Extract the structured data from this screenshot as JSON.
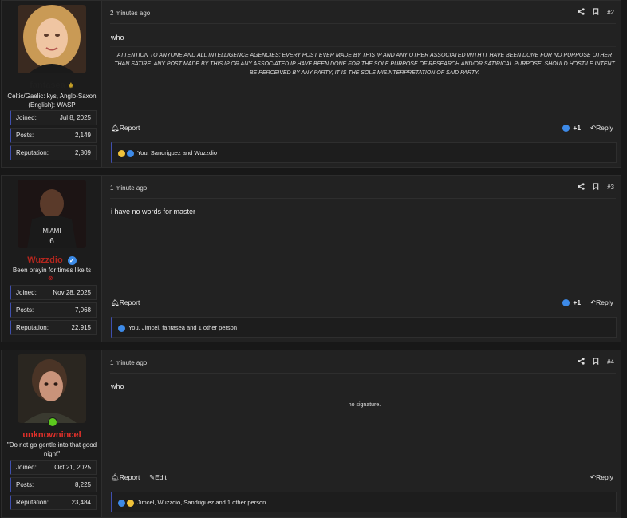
{
  "posts": [
    {
      "username": "fantasea",
      "user_title": "Celtic/Gaelic: kys, Anglo-Saxon (English): WASP",
      "joined_label": "Joined:",
      "joined": "Jul 8, 2025",
      "posts_label": "Posts:",
      "posts": "2,149",
      "rep_label": "Reputation:",
      "reputation": "2,809",
      "time": "2 minutes ago",
      "number": "#2",
      "message": "who",
      "signature": "ATTENTION TO ANYONE AND ALL INTELLIGENCE AGENCIES: EVERY POST EVER MADE BY THIS IP AND ANY OTHER ASSOCIATED WITH IT HAVE BEEN DONE FOR NO PURPOSE OTHER THAN SATIRE. ANY POST MADE BY THIS IP OR ANY ASSOCIATED IP HAVE BEEN DONE FOR THE SOLE PURPOSE OF RESEARCH AND/OR SATIRICAL PURPOSE. SHOULD HOSTILE INTENT BE PERCEIVED BY ANY PARTY, IT IS THE SOLE MISINTERPRETATION OF SAID PARTY.",
      "report": "Report",
      "score": "+1",
      "reply": "Reply",
      "reactions": "You, Sandriguez and Wuzzdio",
      "name_color": "#1f1f1f"
    },
    {
      "username": "Wuzzdio",
      "user_title": "Been prayin for times like ts",
      "joined_label": "Joined:",
      "joined": "Nov 28, 2025",
      "posts_label": "Posts:",
      "posts": "7,068",
      "rep_label": "Reputation:",
      "reputation": "22,915",
      "time": "1 minute ago",
      "number": "#3",
      "message": "i have no words for master",
      "report": "Report",
      "score": "+1",
      "reply": "Reply",
      "reactions": "You, Jimcel, fantasea and 1 other person",
      "name_color": "#b3261e"
    },
    {
      "username": "unknownincel",
      "user_title": "\"Do not go gentle into that good night\"",
      "joined_label": "Joined:",
      "joined": "Oct 21, 2025",
      "posts_label": "Posts:",
      "posts": "8,225",
      "rep_label": "Reputation:",
      "reputation": "23,484",
      "time": "1 minute ago",
      "number": "#4",
      "message": "who",
      "signature": "no signature.",
      "report": "Report",
      "edit": "Edit",
      "reply": "Reply",
      "reactions": "Jimcel, Wuzzdio, Sandriguez and 1 other person",
      "name_color": "#e0302a"
    }
  ],
  "icons": {
    "share": "share-icon",
    "bookmark": "bookmark-icon",
    "bell": "bell-icon",
    "reply": "reply-icon",
    "like": "like-icon",
    "laugh": "laugh-icon",
    "pencil": "pencil-icon",
    "verified": "verified-badge-icon",
    "online": "online-indicator-icon"
  },
  "colors": {
    "accent": "#3f4fae",
    "like": "#3d8ae8",
    "online": "#5cc81e"
  }
}
